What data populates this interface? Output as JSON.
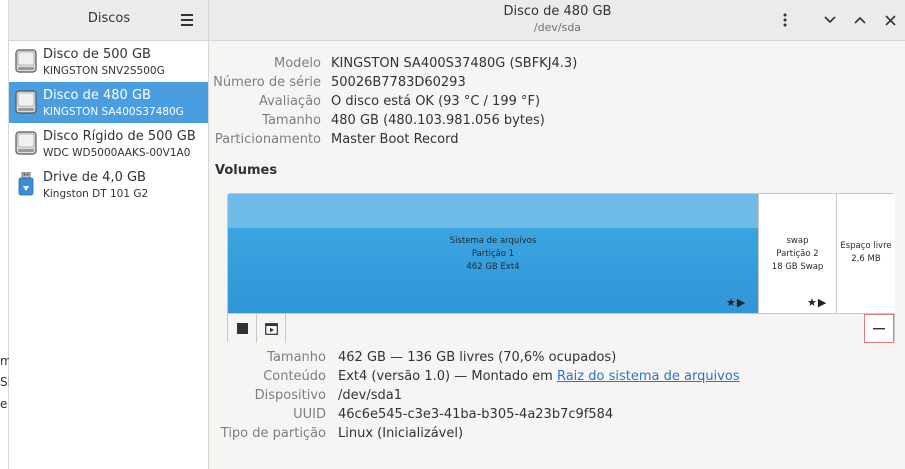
{
  "sidebar": {
    "title": "Discos",
    "disks": [
      {
        "name": "Disco de 500 GB",
        "model": "KINGSTON SNV2S500G",
        "icon": "drive-harddisk-icon",
        "selected": false
      },
      {
        "name": "Disco de 480 GB",
        "model": "KINGSTON SA400S37480G",
        "icon": "drive-harddisk-icon",
        "selected": true
      },
      {
        "name": "Disco Rígido de 500 GB",
        "model": "WDC WD5000AAKS-00V1A0",
        "icon": "drive-harddisk-icon",
        "selected": false
      },
      {
        "name": "Drive de 4,0 GB",
        "model": "Kingston DT 101 G2",
        "icon": "usb-drive-icon",
        "selected": false
      }
    ]
  },
  "header": {
    "title": "Disco de 480 GB",
    "subtitle": "/dev/sda"
  },
  "disk_info": [
    {
      "label": "Modelo",
      "value": "KINGSTON SA400S37480G (SBFKJ4.3)"
    },
    {
      "label": "Número de série",
      "value": "50026B7783D60293"
    },
    {
      "label": "Avaliação",
      "value": "O disco está OK (93 °C / 199 °F)"
    },
    {
      "label": "Tamanho",
      "value": "480 GB (480.103.981.056 bytes)"
    },
    {
      "label": "Particionamento",
      "value": "Master Boot Record"
    }
  ],
  "volumes": {
    "title": "Volumes",
    "partitions": [
      {
        "line1": "Sistema de arquivos",
        "line2": "Partição 1",
        "line3": "462 GB Ext4"
      },
      {
        "line1": "swap",
        "line2": "Partição 2",
        "line3": "18 GB Swap"
      },
      {
        "line1": "Espaço livre",
        "line2": "2,6 MB"
      }
    ]
  },
  "volume_info": {
    "size_label": "Tamanho",
    "size_value": "462 GB — 136 GB livres (70,6% ocupados)",
    "content_label": "Conteúdo",
    "content_value": "Ext4 (versão 1.0) — Montado em",
    "content_link": "Raiz do sistema de arquivos",
    "device_label": "Dispositivo",
    "device_value": "/dev/sda1",
    "uuid_label": "UUID",
    "uuid_value": "46c6e545-c3e3-41ba-b305-4a23b7c9f584",
    "ptype_label": "Tipo de partição",
    "ptype_value": "Linux (Inicializável)"
  },
  "background_fragments": [
    "m",
    "SE",
    "e"
  ],
  "colors": {
    "selection": "#4a9ee0",
    "partition_fill": "#3aa4e0",
    "link": "#2a76c6"
  }
}
